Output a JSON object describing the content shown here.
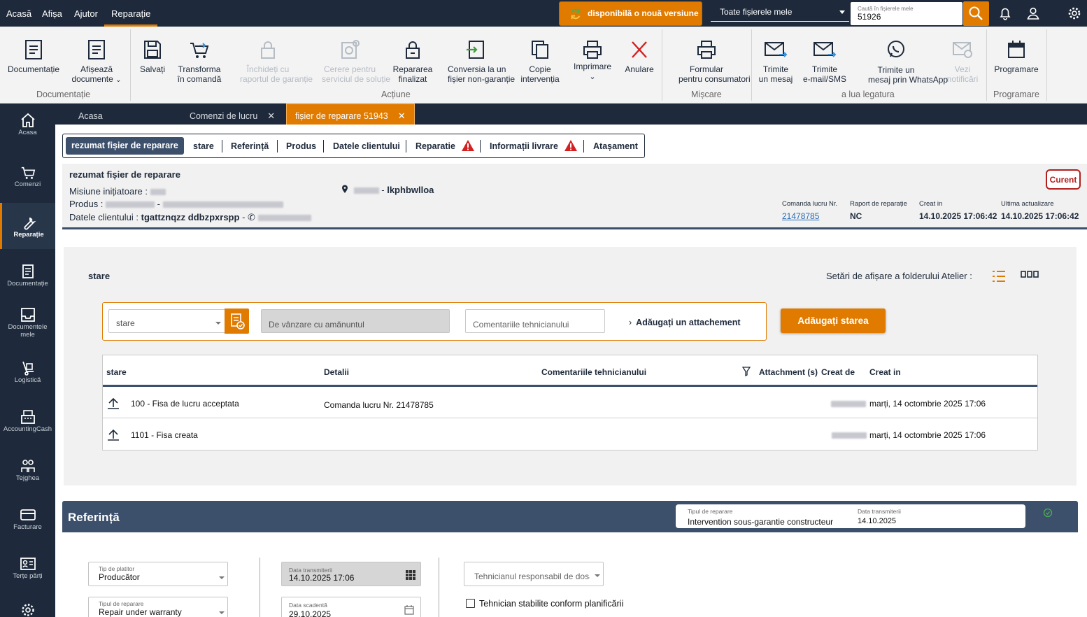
{
  "topnav": {
    "acasa": "Acasă",
    "afisa": "Afișa",
    "ajutor": "Ajutor",
    "reparatie": "Reparație"
  },
  "update": {
    "label": "disponibilă o nouă versiune"
  },
  "files_select": {
    "value": "Toate fișierele mele"
  },
  "search": {
    "placeholder_label": "Caută în fișierele mele",
    "value": "51926"
  },
  "ribbon": {
    "documentatie": "Documentație",
    "afiseaza_1": "Afișează",
    "afiseaza_2": "documente",
    "salvati": "Salvați",
    "transforma_1": "Transforma",
    "transforma_2": "în comandă",
    "inchideti_1": "Închideți cu",
    "inchideti_2": "raportul de garanție",
    "cerere_1": "Cerere pentru",
    "cerere_2": "serviciul de soluție",
    "reparare_1": "Repararea",
    "reparare_2": "finalizat",
    "conversia_1": "Conversia la un",
    "conversia_2": "fișier non-garanție",
    "copie_1": "Copie",
    "copie_2": "intervenția",
    "imprimare": "Imprimare",
    "anulare": "Anulare",
    "formular_1": "Formular",
    "formular_2": "pentru consumatori",
    "trimite_mesaj_1": "Trimite",
    "trimite_mesaj_2": "un mesaj",
    "trimite_email_1": "Trimite",
    "trimite_email_2": "e-mail/SMS",
    "trimite_wa_1": "Trimite un",
    "trimite_wa_2": "mesaj prin WhatsApp",
    "vezi_1": "Vezi",
    "vezi_2": "notificări",
    "programare": "Programare",
    "groups": {
      "documentatie": "Documentație",
      "actiune": "Acțiune",
      "miscare": "Mișcare",
      "legatura": "a lua legatura",
      "programare": "Programare"
    }
  },
  "sidebar": {
    "acasa": "Acasa",
    "comenzi": "Comenzi",
    "reparatie": "Reparație",
    "documentatie": "Documentație",
    "documentele_1": "Documentele",
    "documentele_2": "mele",
    "logistica": "Logistică",
    "accounting": "AccountingCash",
    "tejghea": "Tejghea",
    "facturare": "Facturare",
    "terte": "Terțe părți"
  },
  "tabs": {
    "acasa": "Acasa",
    "comenzi": "Comenzi de lucru",
    "fisier": "fișier de reparare 51943"
  },
  "subtabs": {
    "rezumat": "rezumat fișier de reparare",
    "stare": "stare",
    "referinta": "Referință",
    "produs": "Produs",
    "datele": "Datele clientului",
    "reparatie": "Reparatie",
    "livrare": "Informații livrare",
    "atasament": "Atașament"
  },
  "summary": {
    "title": "rezumat fișier de reparare",
    "misiune": "Misiune inițiatoare :",
    "produs": "Produs :",
    "datele": "Datele clientului :",
    "client_name": "tgattznqzz ddbzpxrspp",
    "dash": "-",
    "location": "lkphbwlloa",
    "status": "Curent",
    "comanda_label": "Comanda lucru Nr.",
    "comanda_value": "21478785",
    "raport_label": "Raport de reparație",
    "raport_value": "NC",
    "creat_label": "Creat in",
    "creat_value": "14.10.2025 17:06:42",
    "ultima_label": "Ultima actualizare",
    "ultima_value": "14.10.2025 17:06:42"
  },
  "stare": {
    "title": "stare",
    "settings_label": "Setări de afișare a folderului Atelier :",
    "select_value": "stare",
    "vanzare": "De vânzare cu amănuntul",
    "comment_ph": "Comentariile tehnicianului",
    "attach": "Adăugați un attachement",
    "add_btn": "Adăugați starea",
    "columns": {
      "stare": "stare",
      "detalii": "Detalii",
      "comentarii": "Comentariile tehnicianului",
      "attachment": "Attachment (s)",
      "creat_de": "Creat de",
      "creat_in": "Creat in"
    },
    "rows": [
      {
        "stare": "100 - Fisa de lucru acceptata",
        "detalii": "Comanda lucru Nr. 21478785",
        "creat_in": "marți, 14 octombrie 2025 17:06"
      },
      {
        "stare": "1101 - Fisa creata",
        "detalii": "",
        "creat_in": "marți, 14 octombrie 2025 17:06"
      }
    ]
  },
  "referinta": {
    "title": "Referință",
    "tip_reparare_label": "Tipul de reparare",
    "tip_reparare_value": "Intervention sous-garantie constructeur",
    "data_trans_label": "Data transmiterii",
    "data_trans_value": "14.10.2025",
    "tip_platitor_label": "Tip de platitor",
    "tip_platitor_value": "Producător",
    "tip_rep2_label": "Tipul de reparare",
    "tip_rep2_value": "Repair under warranty",
    "data_trans2_label": "Data transmiterii",
    "data_trans2_value": "14.10.2025 17:06",
    "data_scad_label": "Data scadentă",
    "data_scad_value": "29.10.2025",
    "tehnician_ph": "Tehnicianul responsabil de dosar",
    "checkbox_label": "Tehnician stabilite conform planificării"
  },
  "colors": {
    "navy": "#1e2a3b",
    "accent": "#e07b00",
    "slate": "#3c4f6b",
    "danger": "#d32020"
  }
}
